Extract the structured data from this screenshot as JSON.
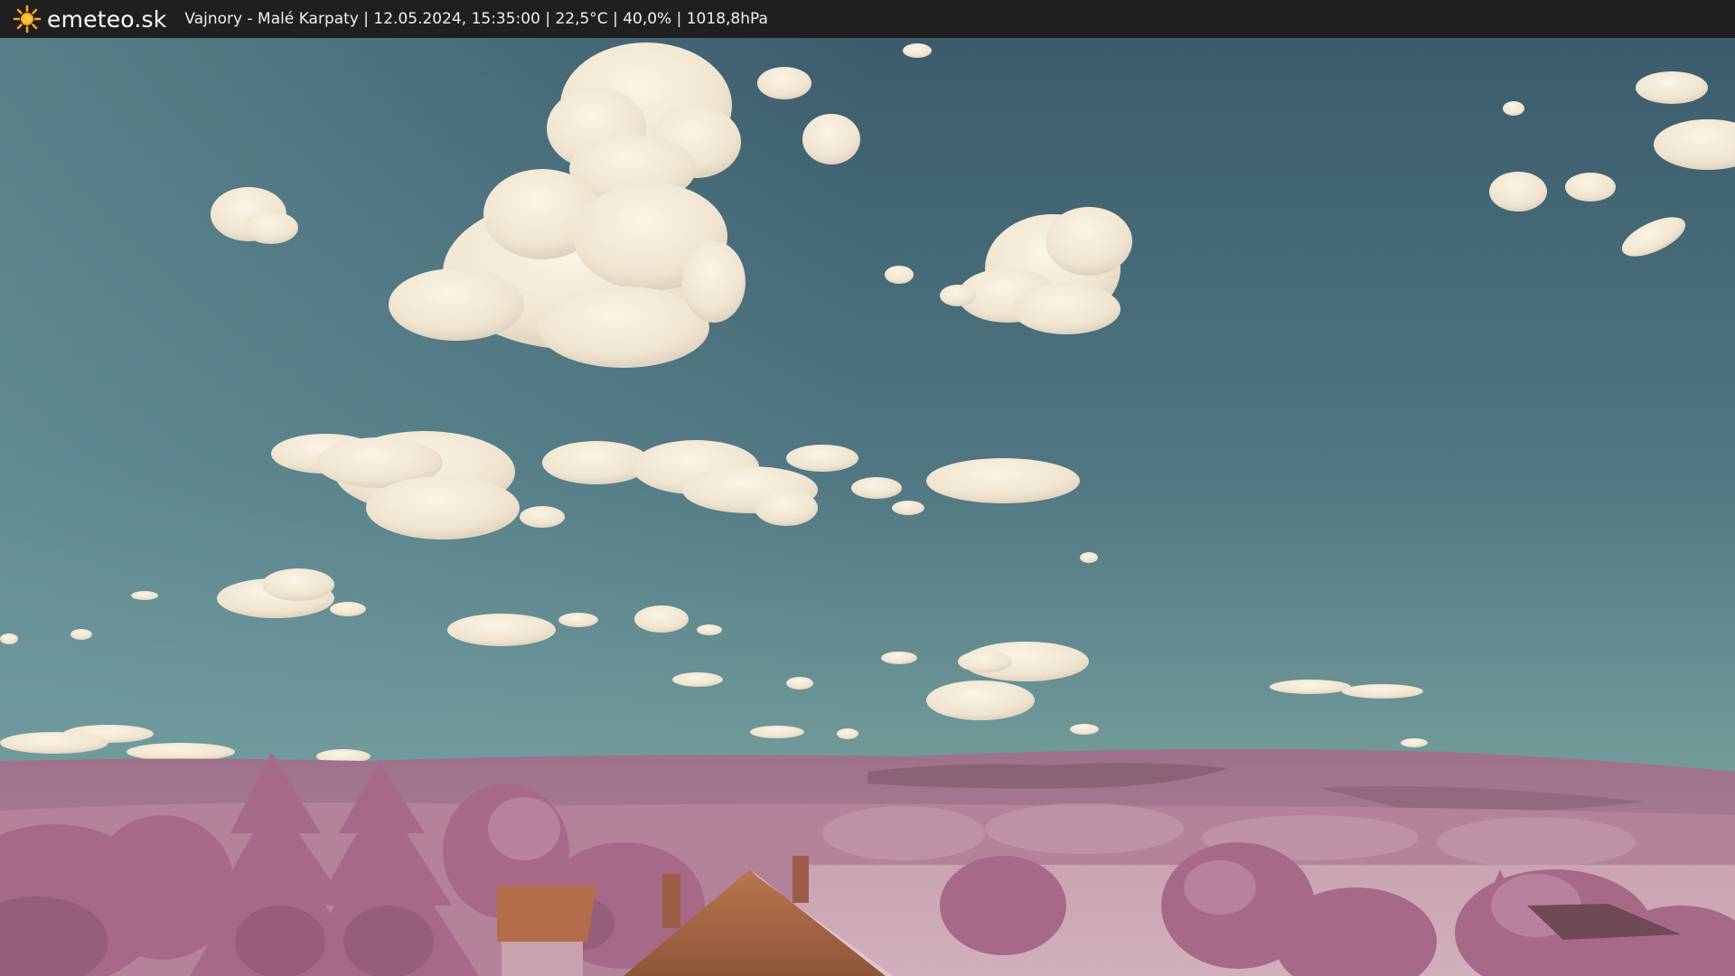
{
  "header": {
    "brand": "emeteo.sk",
    "station_info": "Vajnory - Malé Karpaty | 12.05.2024, 15:35:00 | 22,5°C | 40,0% | 1018,8hPa",
    "logo_icon": "sun-icon",
    "logo_color": "#f5a623"
  },
  "webcam": {
    "scene": "infrared landscape webcam",
    "colors": {
      "sky_top": "#3f5e6c",
      "sky_horizon": "#7fa8a8",
      "cloud": "#f3ead8",
      "vegetation": "#a86e8a",
      "hills": "#9a6e83",
      "roof": "#b9714e"
    }
  }
}
